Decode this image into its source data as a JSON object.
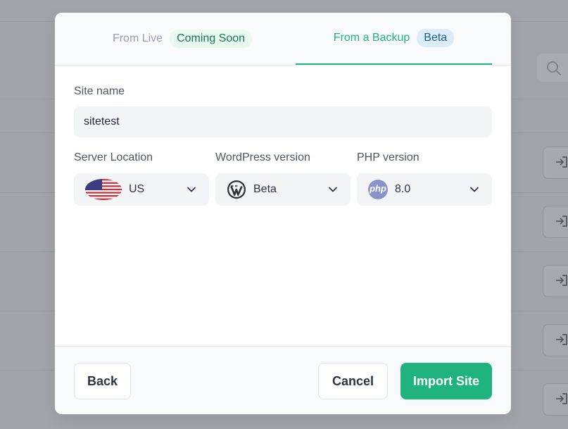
{
  "tabs": [
    {
      "label": "From Live",
      "badge": "Coming Soon"
    },
    {
      "label": "From a Backup",
      "badge": "Beta"
    }
  ],
  "form": {
    "site_name_label": "Site name",
    "site_name_value": "sitetest",
    "server_location_label": "Server Location",
    "server_location_value": "US",
    "wordpress_version_label": "WordPress version",
    "wordpress_version_value": "Beta",
    "php_version_label": "PHP version",
    "php_version_value": "8.0",
    "php_logo_text": "php"
  },
  "footer": {
    "back_label": "Back",
    "cancel_label": "Cancel",
    "import_label": "Import Site"
  },
  "colors": {
    "accent": "#1fb47f",
    "overlay": "#a1a5ab"
  },
  "icons": {
    "flag": "us-flag-icon",
    "wordpress": "wordpress-icon",
    "php": "php-icon",
    "chevron": "chevron-down-icon",
    "search": "search-icon",
    "action": "sign-in-icon"
  }
}
